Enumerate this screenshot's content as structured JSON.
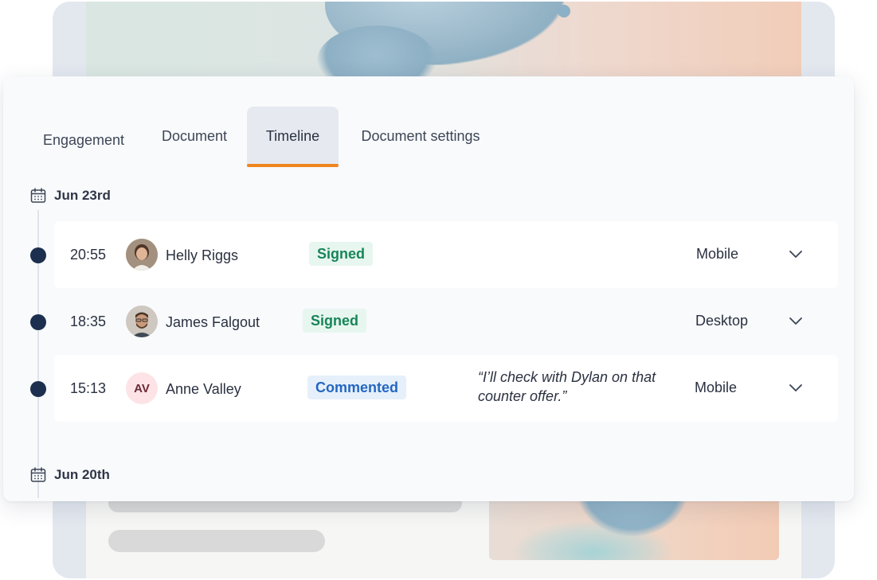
{
  "tabs": [
    {
      "label": "Engagement"
    },
    {
      "label": "Document"
    },
    {
      "label": "Timeline",
      "active": true
    },
    {
      "label": "Document settings"
    }
  ],
  "accent_color": "#f0851f",
  "dates": [
    "Jun 23rd",
    "Jun 20th"
  ],
  "entries": [
    {
      "time": "20:55",
      "name": "Helly Riggs",
      "status": "Signed",
      "comment": "",
      "device": "Mobile",
      "avatar": "photo"
    },
    {
      "time": "18:35",
      "name": "James Falgout",
      "status": "Signed",
      "comment": "",
      "device": "Desktop",
      "avatar": "photo"
    },
    {
      "time": "15:13",
      "name": "Anne Valley",
      "initials": "AV",
      "status": "Commented",
      "comment": "“I’ll check with Dylan on that counter offer.”",
      "device": "Mobile",
      "avatar": "initials"
    }
  ],
  "status_colors": {
    "Signed": "#17855a",
    "Commented": "#2467c1"
  },
  "icons": [
    "calendar-icon",
    "chevron-down-icon"
  ]
}
